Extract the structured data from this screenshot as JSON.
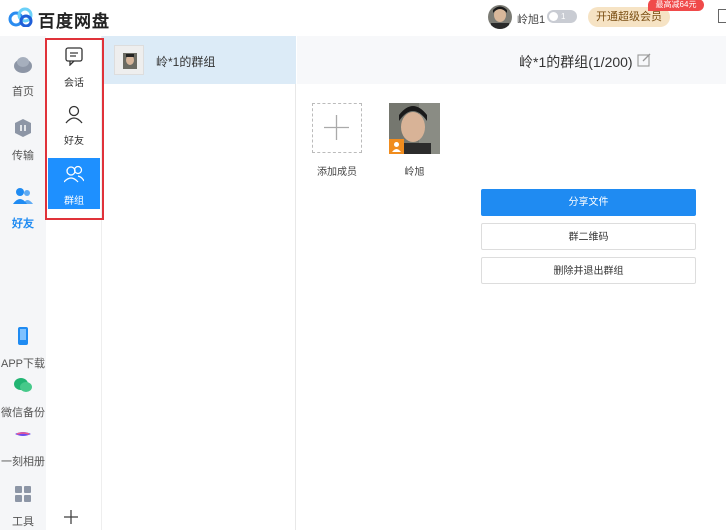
{
  "app": {
    "name": "百度网盘",
    "user_name": "岭旭1",
    "vip_level": "1",
    "upgrade_label": "开通超级会员",
    "promo_text": "最高减64元"
  },
  "nav": {
    "items": [
      {
        "label": "首页",
        "icon": "cloud-home-icon"
      },
      {
        "label": "传输",
        "icon": "transfer-icon"
      },
      {
        "label": "好友",
        "icon": "friends-icon",
        "active": true
      },
      {
        "label": "APP下载",
        "icon": "phone-icon"
      },
      {
        "label": "微信备份",
        "icon": "wechat-backup-icon"
      },
      {
        "label": "一刻相册",
        "icon": "album-icon"
      },
      {
        "label": "工具",
        "icon": "tools-icon"
      }
    ]
  },
  "subnav": {
    "items": [
      {
        "label": "会话",
        "icon": "chat-icon"
      },
      {
        "label": "好友",
        "icon": "user-icon"
      },
      {
        "label": "群组",
        "icon": "group-icon",
        "active": true
      }
    ],
    "add_icon": "plus-icon"
  },
  "group_list": {
    "items": [
      {
        "name": "岭*1的群组",
        "selected": true
      }
    ]
  },
  "group_detail": {
    "title": "岭*1的群组(1/200)",
    "add_member_label": "添加成员",
    "member_name": "岭旭",
    "buttons": {
      "share": "分享文件",
      "qrcode": "群二维码",
      "delete_exit": "删除并退出群组"
    }
  },
  "colors": {
    "accent": "#1f8bf2",
    "selected_row": "#dcebf7",
    "highlight_box": "#e0323a"
  }
}
